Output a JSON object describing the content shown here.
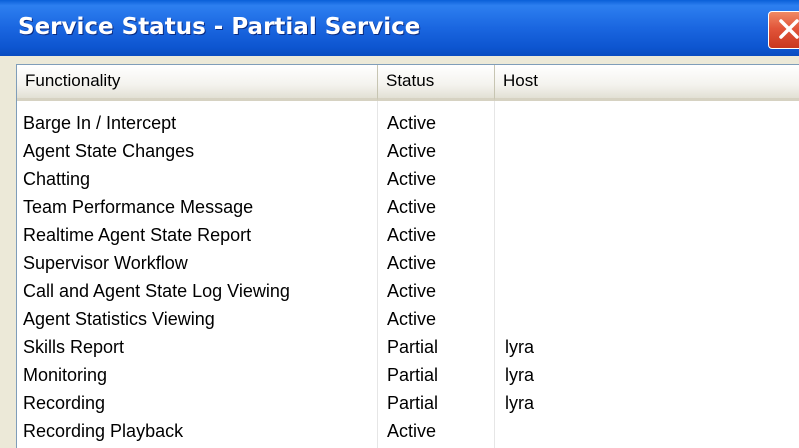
{
  "window": {
    "title": "Service Status - Partial Service"
  },
  "columns": {
    "functionality": "Functionality",
    "status": "Status",
    "host": "Host"
  },
  "rows": [
    {
      "functionality": "Barge In / Intercept",
      "status": "Active",
      "host": ""
    },
    {
      "functionality": "Agent State Changes",
      "status": "Active",
      "host": ""
    },
    {
      "functionality": "Chatting",
      "status": "Active",
      "host": ""
    },
    {
      "functionality": "Team Performance Message",
      "status": "Active",
      "host": ""
    },
    {
      "functionality": "Realtime Agent State Report",
      "status": "Active",
      "host": ""
    },
    {
      "functionality": "Supervisor Workflow",
      "status": "Active",
      "host": ""
    },
    {
      "functionality": "Call and Agent State Log Viewing",
      "status": "Active",
      "host": ""
    },
    {
      "functionality": "Agent Statistics Viewing",
      "status": "Active",
      "host": ""
    },
    {
      "functionality": "Skills Report",
      "status": "Partial",
      "host": "lyra"
    },
    {
      "functionality": "Monitoring",
      "status": "Partial",
      "host": "lyra"
    },
    {
      "functionality": "Recording",
      "status": "Partial",
      "host": "lyra"
    },
    {
      "functionality": "Recording Playback",
      "status": "Active",
      "host": ""
    }
  ],
  "icons": {
    "close": "close-icon"
  },
  "colors": {
    "titlebar": "#0a5fd8",
    "close_button": "#e2553a",
    "header_bg": "#f4f3ee",
    "window_bg": "#ece9d8"
  }
}
